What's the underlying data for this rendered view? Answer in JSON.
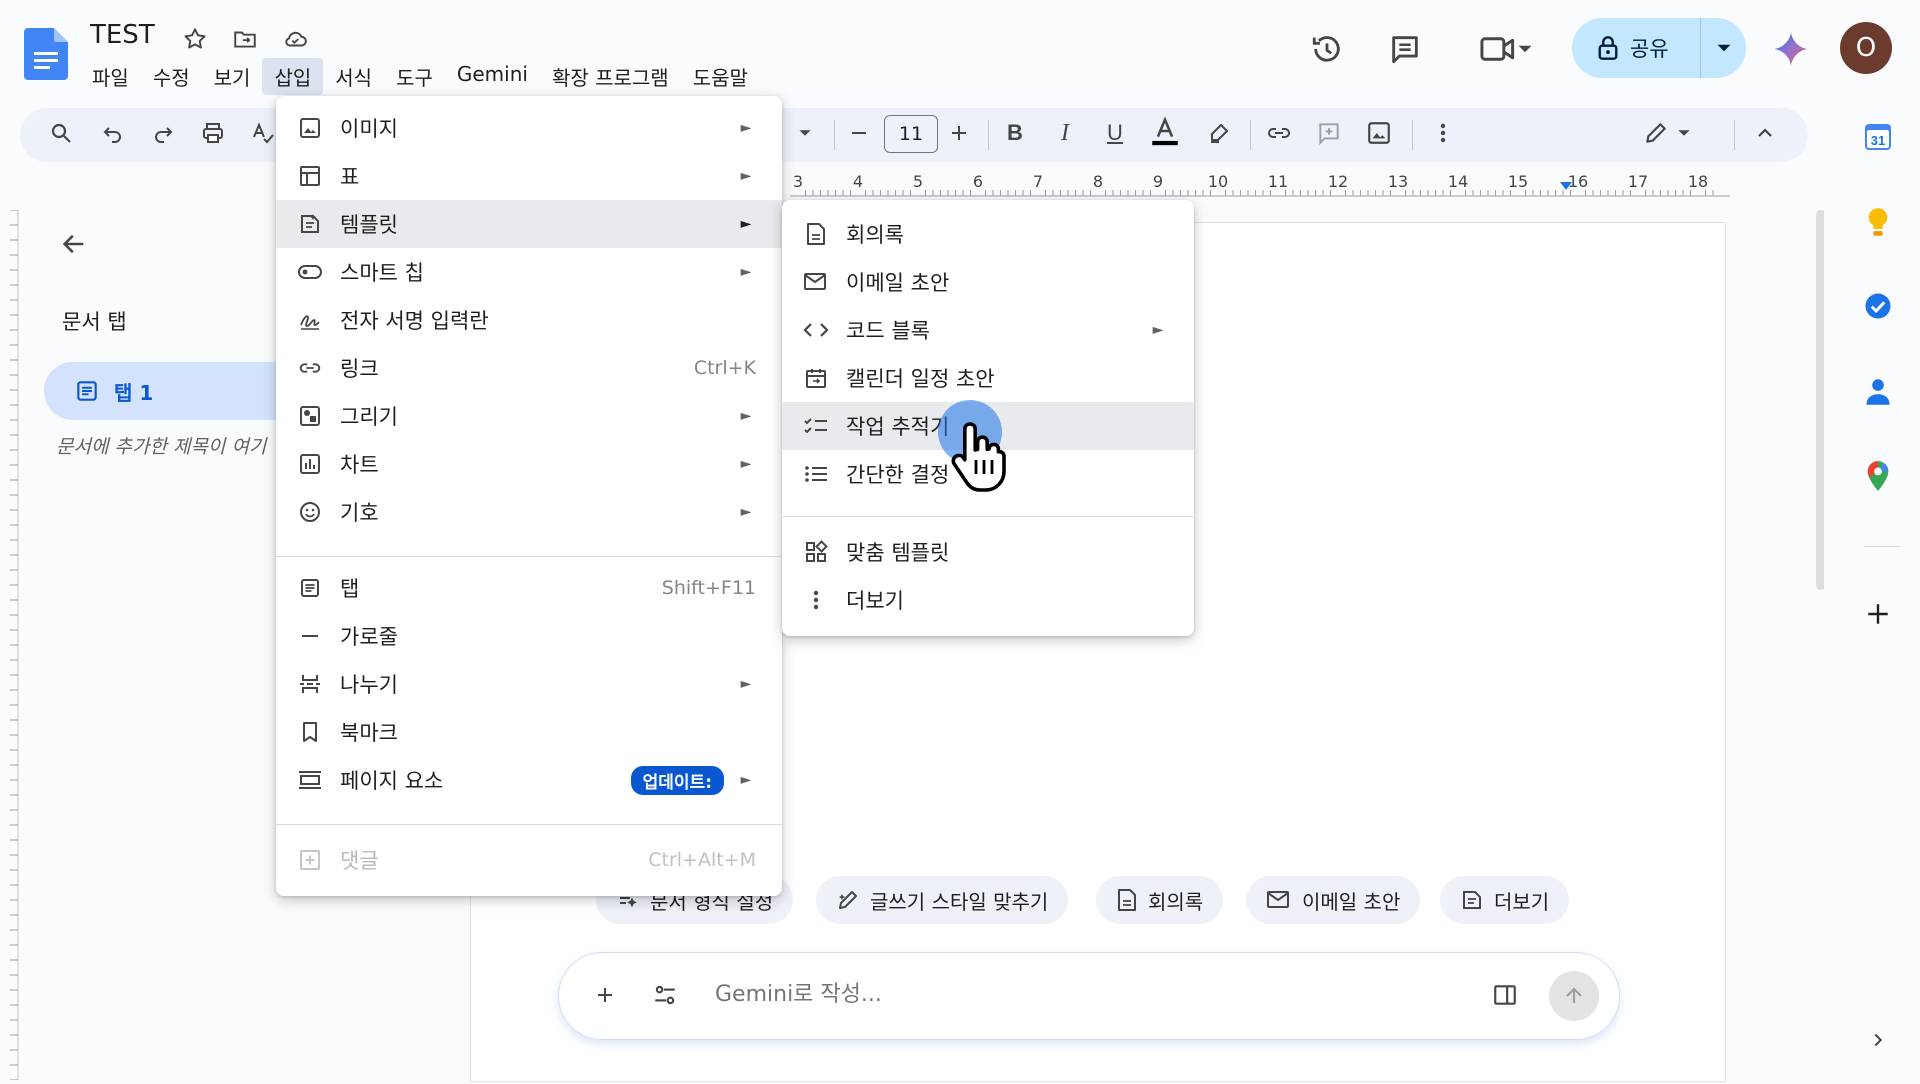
{
  "app": {
    "title": "TEST",
    "menu": [
      "파일",
      "수정",
      "보기",
      "삽입",
      "서식",
      "도구",
      "Gemini",
      "확장 프로그램",
      "도움말"
    ],
    "active_menu": "삽입",
    "share_label": "공유",
    "avatar_initial": "O",
    "accent_color": "#0b57d0"
  },
  "toolbar": {
    "font_size": "11"
  },
  "ruler": {
    "labels": [
      "3",
      "4",
      "5",
      "6",
      "7",
      "8",
      "9",
      "10",
      "11",
      "12",
      "13",
      "14",
      "15",
      "16",
      "17",
      "18"
    ]
  },
  "tabs_panel": {
    "title": "문서 탭",
    "tab_label": "탭 1",
    "hint": "문서에 추가한 제목이 여기"
  },
  "insert_menu": {
    "items": [
      {
        "label": "이미지",
        "icon": "image-icon",
        "submenu": true
      },
      {
        "label": "표",
        "icon": "table-icon",
        "submenu": true
      },
      {
        "label": "템플릿",
        "icon": "template-icon",
        "submenu": true,
        "hover": true
      },
      {
        "label": "스마트 칩",
        "icon": "smart-chip-icon",
        "submenu": true
      },
      {
        "label": "전자 서명 입력란",
        "icon": "signature-icon"
      },
      {
        "label": "링크",
        "icon": "link-icon",
        "shortcut": "Ctrl+K"
      },
      {
        "label": "그리기",
        "icon": "drawing-icon",
        "submenu": true
      },
      {
        "label": "차트",
        "icon": "chart-icon",
        "submenu": true
      },
      {
        "label": "기호",
        "icon": "emoji-icon",
        "submenu": true
      },
      {
        "label": "탭",
        "icon": "tab-icon",
        "shortcut": "Shift+F11"
      },
      {
        "label": "가로줄",
        "icon": "horizontal-line-icon"
      },
      {
        "label": "나누기",
        "icon": "break-icon",
        "submenu": true
      },
      {
        "label": "북마크",
        "icon": "bookmark-icon"
      },
      {
        "label": "페이지 요소",
        "icon": "page-elements-icon",
        "submenu": true,
        "badge": "업데이트:"
      },
      {
        "label": "댓글",
        "icon": "comment-icon",
        "shortcut": "Ctrl+Alt+M",
        "disabled": true
      }
    ]
  },
  "template_menu": {
    "items": [
      {
        "label": "회의록",
        "icon": "document-icon"
      },
      {
        "label": "이메일 초안",
        "icon": "email-icon"
      },
      {
        "label": "코드 블록",
        "icon": "code-icon",
        "submenu": true
      },
      {
        "label": "캘린더 일정 초안",
        "icon": "calendar-icon"
      },
      {
        "label": "작업 추적기",
        "icon": "checklist-icon",
        "hover": true
      },
      {
        "label": "간단한 결정",
        "icon": "list-icon"
      },
      {
        "label": "맞춤 템플릿",
        "icon": "custom-template-icon"
      },
      {
        "label": "더보기",
        "icon": "more-vert-icon"
      }
    ]
  },
  "gemini": {
    "chips": [
      {
        "label": "문서 형식 설정",
        "icon": "format-icon"
      },
      {
        "label": "글쓰기 스타일 맞추기",
        "icon": "style-icon"
      },
      {
        "label": "회의록",
        "icon": "document-icon"
      },
      {
        "label": "이메일 초안",
        "icon": "email-icon"
      },
      {
        "label": "더보기",
        "icon": "template-icon"
      }
    ],
    "placeholder": "Gemini로 작성..."
  },
  "side_panel": {
    "calendar_day": "31"
  }
}
